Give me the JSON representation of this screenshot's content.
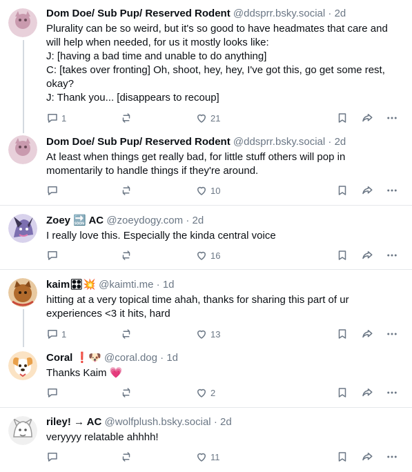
{
  "posts": [
    {
      "name": "Dom Doe/ Sub Pup/ Reserved Rodent",
      "handle": "@ddsprr.bsky.social",
      "time": "2d",
      "text": "Plurality can be so weird, but it's so good to have headmates that care and will help when needed, for us it mostly looks like:\nJ: [having a bad time and unable to do anything]\nC: [takes over fronting] Oh, shoot, hey, hey, I've got this, go get some rest, okay?\nJ: Thank you... [disappears to recoup]",
      "replies": "1",
      "reposts": "",
      "likes": "21",
      "avatar_color": "#d9b8c8"
    },
    {
      "name": "Dom Doe/ Sub Pup/ Reserved Rodent",
      "handle": "@ddsprr.bsky.social",
      "time": "2d",
      "text": "At least when things get really bad, for little stuff others will pop in momentarily to handle things if they're around.",
      "replies": "",
      "reposts": "",
      "likes": "10",
      "avatar_color": "#d9b8c8"
    },
    {
      "name": "Zoey 🔜 AC",
      "handle": "@zoeydogy.com",
      "time": "2d",
      "text": "I really love this. Especially the kinda central voice",
      "replies": "",
      "reposts": "",
      "likes": "16",
      "avatar_color": "#7c6fb0"
    },
    {
      "name": "kaim🎛💥",
      "handle": "@kaimti.me",
      "time": "1d",
      "text": "hitting at a very topical time ahah, thanks for sharing this part of ur experiences <3 it hits, hard",
      "replies": "1",
      "reposts": "",
      "likes": "13",
      "avatar_color": "#b06a2c"
    },
    {
      "name": "Coral ❗🐶",
      "handle": "@coral.dog",
      "time": "1d",
      "text": "Thanks Kaim 💗",
      "replies": "",
      "reposts": "",
      "likes": "2",
      "avatar_color": "#e9a04a"
    },
    {
      "name": "riley! → AC",
      "handle": "@wolfplush.bsky.social",
      "time": "2d",
      "text": "veryyyy relatable ahhhh!",
      "replies": "",
      "reposts": "",
      "likes": "11",
      "avatar_color": "#dcdcdc"
    }
  ],
  "icons": [
    "reply-icon",
    "repost-icon",
    "like-icon",
    "bookmark-icon",
    "share-icon",
    "more-icon"
  ],
  "colors": {
    "muted": "#6b7785",
    "text": "#0b0f14",
    "separator": "#e5e7eb",
    "thread_line": "#d4d9e0"
  }
}
